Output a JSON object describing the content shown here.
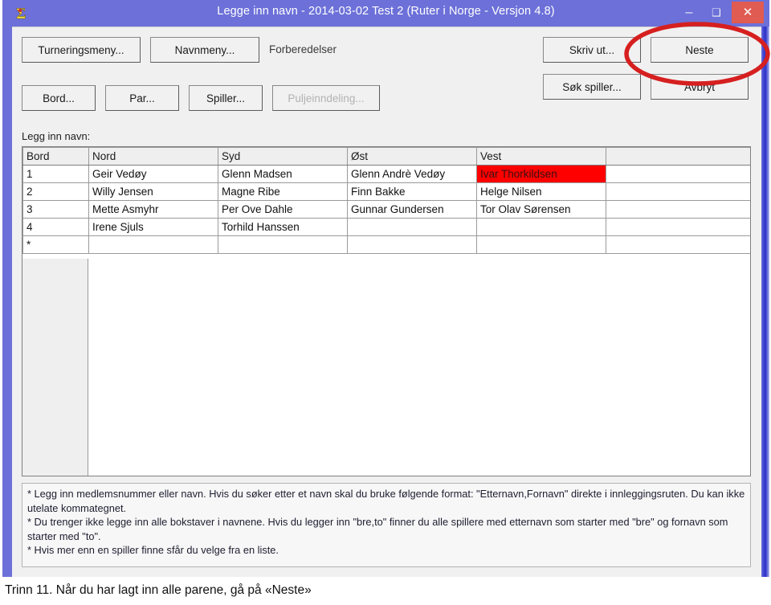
{
  "window": {
    "title": "Legge inn navn - 2014-03-02  Test 2  (Ruter i Norge - Versjon 4.8)",
    "icon": "sigma-icon",
    "minimize_label": "–",
    "maximize_label": "❑",
    "close_label": "✕",
    "close_color": "#e05b52",
    "titlebar_color": "#6c70d8"
  },
  "toolbar": {
    "row1": [
      {
        "label": "Turneringsmeny...",
        "name": "tournament-menu-button",
        "enabled": true
      },
      {
        "label": "Navnmeny...",
        "name": "name-menu-button",
        "enabled": true
      }
    ],
    "row2": [
      {
        "label": "Bord...",
        "name": "table-button",
        "enabled": true
      },
      {
        "label": "Par...",
        "name": "pair-button",
        "enabled": true
      },
      {
        "label": "Spiller...",
        "name": "player-button",
        "enabled": true
      },
      {
        "label": "Puljeinndeling...",
        "name": "group-division-button",
        "enabled": false
      }
    ],
    "mode_label": "Forberedelser",
    "right": [
      {
        "label": "Skriv ut...",
        "name": "print-button",
        "enabled": true
      },
      {
        "label": "Neste",
        "name": "next-button",
        "enabled": true
      },
      {
        "label": "Søk spiller...",
        "name": "search-player-button",
        "enabled": true
      },
      {
        "label": "Avbryt",
        "name": "cancel-button",
        "enabled": true
      }
    ]
  },
  "grid": {
    "caption": "Legg inn navn:",
    "headers": [
      "Bord",
      "Nord",
      "Syd",
      "Øst",
      "Vest",
      ""
    ],
    "rows": [
      {
        "bord": "1",
        "nord": "Geir Vedøy",
        "syd": "Glenn Madsen",
        "ost": "Glenn Andrè Vedøy",
        "vest": "Ivar Thorkildsen"
      },
      {
        "bord": "2",
        "nord": "Willy Jensen",
        "syd": "Magne Ribe",
        "ost": "Finn Bakke",
        "vest": "Helge Nilsen"
      },
      {
        "bord": "3",
        "nord": "Mette Asmyhr",
        "syd": "Per Ove Dahle",
        "ost": "Gunnar Gundersen",
        "vest": "Tor Olav Sørensen"
      },
      {
        "bord": "4",
        "nord": "Irene Sjuls",
        "syd": "Torhild Hanssen",
        "ost": "",
        "vest": ""
      },
      {
        "bord": "*",
        "nord": "",
        "syd": "",
        "ost": "",
        "vest": ""
      }
    ],
    "highlight_cell": {
      "row": 0,
      "column": "vest",
      "color": "#fe0000"
    },
    "focused_cell": {
      "row": 3,
      "column": "ost"
    }
  },
  "help": {
    "line1": "* Legg inn medlemsnummer eller navn. Hvis du søker etter et navn skal du bruke følgende format: \"Etternavn,Fornavn\" direkte i innleggingsruten. Du kan ikke utelate kommategnet.",
    "line2": "* Du trenger ikke legge inn alle bokstaver i navnene. Hvis du legger inn \"bre,to\" finner du alle spillere med etternavn som starter med \"bre\" og fornavn som starter med \"to\".",
    "line3": "* Hvis mer enn en spiller finne sfår du velge fra en liste."
  },
  "annotation": {
    "shape": "ellipse",
    "color": "#d61f1f",
    "target": "Neste"
  },
  "caption": "Trinn 11. Når du har lagt inn alle parene, gå på «Neste»"
}
